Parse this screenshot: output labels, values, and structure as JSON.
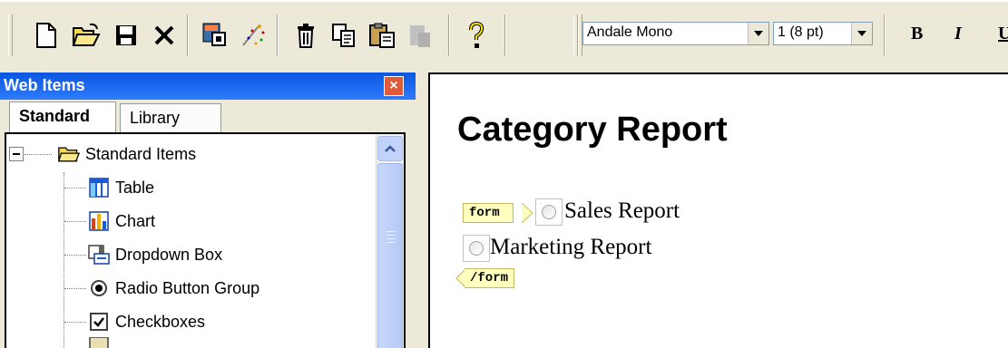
{
  "toolbar": {
    "buttons": [
      "new-icon",
      "open-icon",
      "save-icon",
      "delete-icon",
      "web-item-icon",
      "wizard-icon",
      "trash-icon",
      "copy-icon",
      "paste-icon",
      "paste-special-icon",
      "help-icon"
    ],
    "font_name": "Andale Mono",
    "font_size": "1 (8 pt)",
    "bold_label": "B",
    "italic_label": "I",
    "underline_label": "U"
  },
  "panel": {
    "title": "Web Items",
    "tabs": [
      {
        "label": "Standard"
      },
      {
        "label": "Library"
      }
    ],
    "tree": {
      "root": "Standard Items",
      "items": [
        {
          "label": "Table"
        },
        {
          "label": "Chart"
        },
        {
          "label": "Dropdown Box"
        },
        {
          "label": "Radio Button Group"
        },
        {
          "label": "Checkboxes"
        }
      ]
    }
  },
  "editor": {
    "heading": "Category Report",
    "form_open_tag": "form",
    "form_close_tag": "/form",
    "radios": [
      {
        "label": "Sales Report"
      },
      {
        "label": "Marketing Report"
      }
    ]
  }
}
